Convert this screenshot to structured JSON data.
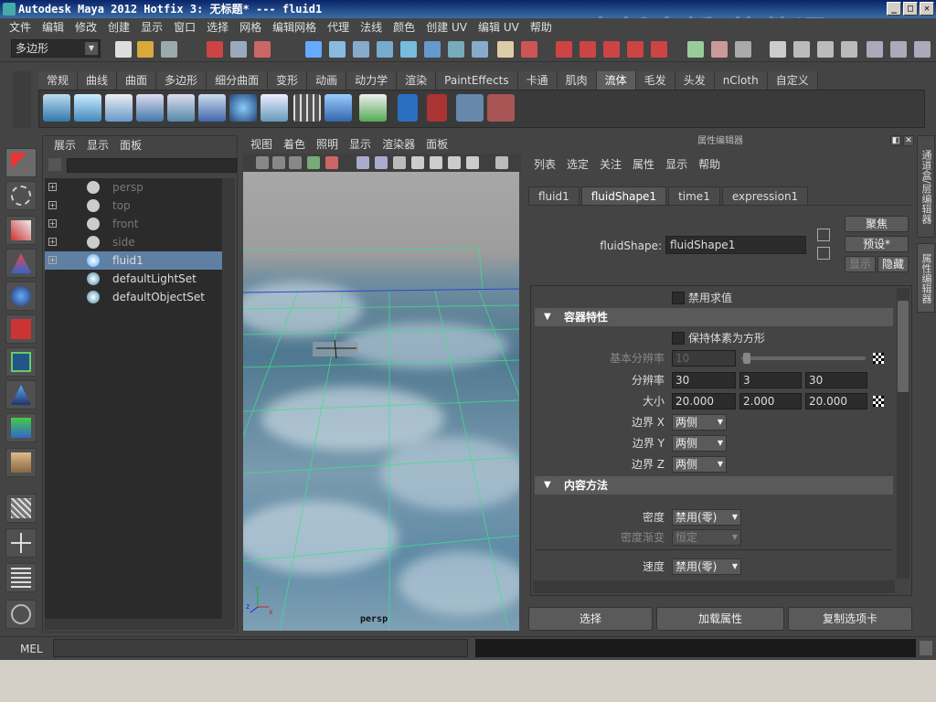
{
  "window": {
    "title": "Autodesk Maya 2012 Hotfix 3: 无标题*    ---    fluid1",
    "watermark": "中新金桥 软件通",
    "controls": [
      "_",
      "□",
      "✕"
    ]
  },
  "menubar": [
    "文件",
    "编辑",
    "修改",
    "创建",
    "显示",
    "窗口",
    "选择",
    "网格",
    "编辑网格",
    "代理",
    "法线",
    "颜色",
    "创建 UV",
    "编辑 UV",
    "帮助"
  ],
  "status_line": {
    "mode": "多边形"
  },
  "shelf": {
    "tabs": [
      "常规",
      "曲线",
      "曲面",
      "多边形",
      "细分曲面",
      "变形",
      "动画",
      "动力学",
      "渲染",
      "PaintEffects",
      "卡通",
      "肌肉",
      "流体",
      "毛发",
      "头发",
      "nCloth",
      "自定义"
    ],
    "active_tab": "流体",
    "icons": [
      "3d-fluid-container-icon",
      "2d-fluid-container-icon",
      "paint-fluids-icon",
      "add-emitter-icon",
      "emit-from-object-icon",
      "make-collide-icon",
      "ocean-icon",
      "pond-icon",
      "grid-display-icon",
      "voxel-icon",
      "fluid-effects-icon",
      "number-one-icon",
      "number-one-red-icon",
      "film-strip-icon",
      "camera-ruler-icon"
    ]
  },
  "outliner": {
    "menu": [
      "展示",
      "显示",
      "面板"
    ],
    "items": [
      {
        "label": "persp",
        "dim": true,
        "expandable": true
      },
      {
        "label": "top",
        "dim": true,
        "expandable": true
      },
      {
        "label": "front",
        "dim": true,
        "expandable": true
      },
      {
        "label": "side",
        "dim": true,
        "expandable": true
      },
      {
        "label": "fluid1",
        "dim": false,
        "expandable": true,
        "selected": true
      },
      {
        "label": "defaultLightSet",
        "dim": false,
        "expandable": false
      },
      {
        "label": "defaultObjectSet",
        "dim": false,
        "expandable": false
      }
    ]
  },
  "viewport": {
    "menu": [
      "视图",
      "着色",
      "照明",
      "显示",
      "渲染器",
      "面板"
    ],
    "camera_label": "persp",
    "axis_labels": {
      "x": "x",
      "y": "y",
      "z": "z"
    }
  },
  "attribute_editor": {
    "title": "属性编辑器",
    "menu": [
      "列表",
      "选定",
      "关注",
      "属性",
      "显示",
      "帮助"
    ],
    "tabs": [
      "fluid1",
      "fluidShape1",
      "time1",
      "expression1"
    ],
    "active_tab": "fluidShape1",
    "node_label": "fluidShape:",
    "node_value": "fluidShape1",
    "focus_button": "聚焦",
    "presets_button": "预设*",
    "show_button": "显示",
    "hide_button": "隐藏",
    "disable_eval": "禁用求值",
    "container_section": "容器特性",
    "keep_voxels_square": "保持体素为方形",
    "base_resolution_label": "基本分辨率",
    "base_resolution": "10",
    "resolution_label": "分辨率",
    "resolution": [
      "30",
      "3",
      "30"
    ],
    "size_label": "大小",
    "size": [
      "20.000",
      "2.000",
      "20.000"
    ],
    "boundary": [
      {
        "label": "边界 X",
        "value": "两侧"
      },
      {
        "label": "边界 Y",
        "value": "两侧"
      },
      {
        "label": "边界 Z",
        "value": "两侧"
      }
    ],
    "contents_section": "内容方法",
    "density_label": "密度",
    "density_value": "禁用(零)",
    "density_gradient_label": "密度渐变",
    "density_gradient_value": "恒定",
    "velocity_label": "速度",
    "velocity_value": "禁用(零)",
    "bottom_buttons": [
      "选择",
      "加载属性",
      "复制选项卡"
    ]
  },
  "right_tabs": [
    "通道盒/层编辑器",
    "属性编辑器"
  ],
  "command_line": {
    "label": "MEL"
  }
}
